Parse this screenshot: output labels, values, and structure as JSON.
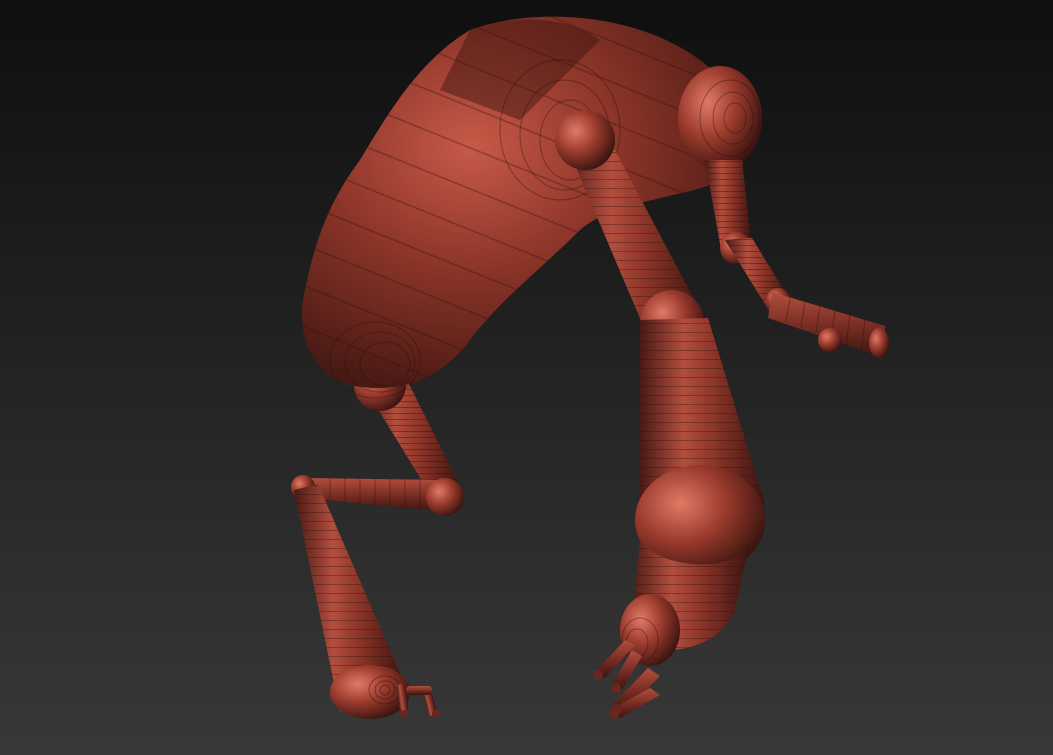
{
  "viewport": {
    "background_top_color": "#0f0f0f",
    "background_bottom_color": "#383838",
    "material_base_color": "#7a2e24",
    "material_highlight_color": "#c85a48",
    "material_shadow_color": "#3a1410",
    "material_band_color": "#5e2219"
  },
  "model": {
    "parts": [
      {
        "id": "torso"
      },
      {
        "id": "head"
      },
      {
        "id": "right-arm-upper"
      },
      {
        "id": "right-arm-lower"
      },
      {
        "id": "right-leg-upper"
      },
      {
        "id": "right-leg-lower"
      },
      {
        "id": "left-leg-upper"
      },
      {
        "id": "left-leg-lower"
      },
      {
        "id": "right-foot-toes"
      },
      {
        "id": "left-foot-toes"
      }
    ]
  }
}
